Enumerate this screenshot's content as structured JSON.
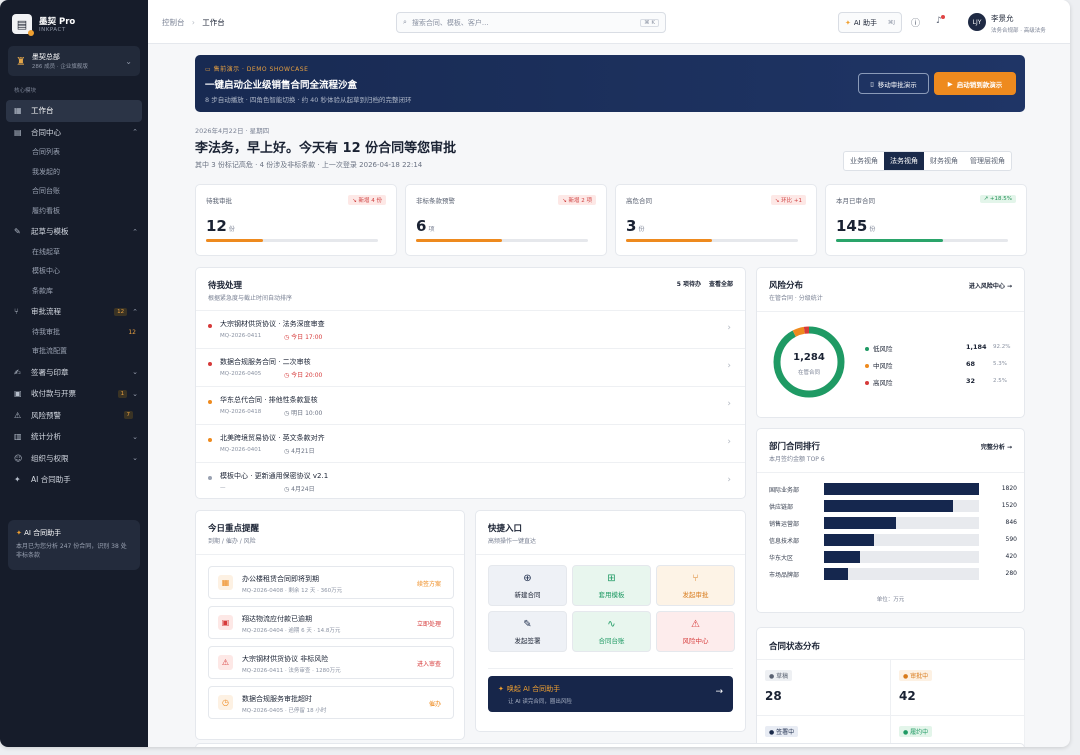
{
  "brand": {
    "name": "墨契 Pro",
    "sub": "INKPACT"
  },
  "org": {
    "name": "墨契总部",
    "sub": "286 成员 · 企业旗舰版"
  },
  "sidebar": {
    "section": "核心模块",
    "items": [
      {
        "label": "工作台",
        "icon": "▦"
      },
      {
        "label": "合同中心",
        "icon": "▤",
        "subs": [
          "合同列表",
          "我发起的",
          "合同台账",
          "履约看板"
        ]
      },
      {
        "label": "起草与模板",
        "icon": "✎",
        "subs": [
          "在线起草",
          "模板中心",
          "条款库"
        ]
      },
      {
        "label": "审批流程",
        "icon": "⑂",
        "count": "12",
        "subs": [
          "待我审批",
          "审批流配置"
        ],
        "subcount": "12"
      },
      {
        "label": "签署与印章",
        "icon": "✍"
      },
      {
        "label": "收付款与开票",
        "icon": "▣",
        "count": "1"
      },
      {
        "label": "风险预警",
        "icon": "⚠",
        "count": "7"
      },
      {
        "label": "统计分析",
        "icon": "▥"
      },
      {
        "label": "组织与权限",
        "icon": "☺"
      },
      {
        "label": "AI 合同助手",
        "icon": "✦"
      }
    ],
    "ai_card": {
      "title": "AI 合同助手",
      "desc": "本月已为您分析 247 份合同，识别 38 处非标条款"
    }
  },
  "topbar": {
    "crumb_root": "控制台",
    "crumb_current": "工作台",
    "search_placeholder": "搜索合同、模板、客户...",
    "search_key": "⌘ K",
    "ai_label": "AI 助手",
    "ai_key": "⌘J",
    "avatar": "LJY",
    "user_name": "李景允",
    "user_role": "法务合规部 · 高级法务"
  },
  "banner": {
    "tag": "售前演示 · DEMO SHOWCASE",
    "title": "一键启动企业级销售合同全流程沙盒",
    "desc": "8 步自动播放 · 四角色智能切换 · 约 40 秒体验从起草到归档的完整闭环",
    "btn_mobile": "移动审批演示",
    "btn_start": "启动销到款演示"
  },
  "header": {
    "date": "2026年4月22日 · 星期四",
    "greeting": "李法务，早上好。今天有 12 份合同等您审批",
    "sub": "其中 3 份标记高危 · 4 份涉及非标条款 · 上一次登录 2026-04-18 22:14",
    "views": [
      "业务视角",
      "法务视角",
      "财务视角",
      "管理层视角"
    ],
    "active_view": 1
  },
  "stats": [
    {
      "label": "待我审批",
      "badge": "↘ 新增 4 份",
      "value": "12",
      "unit": "份",
      "progress": 0.33,
      "color": "#ee8a1e",
      "badge_type": "r"
    },
    {
      "label": "非标条款预警",
      "badge": "↘ 新增 2 项",
      "value": "6",
      "unit": "项",
      "progress": 0.5,
      "color": "#ee8a1e",
      "badge_type": "r"
    },
    {
      "label": "高危合同",
      "badge": "↘ 环比 +1",
      "value": "3",
      "unit": "份",
      "progress": 0.5,
      "color": "#ee8a1e",
      "badge_type": "r"
    },
    {
      "label": "本月已审合同",
      "badge": "↗ +18.5%",
      "value": "145",
      "unit": "份",
      "progress": 0.62,
      "color": "#2aa46a",
      "badge_type": "g"
    }
  ],
  "pending": {
    "title": "待我处理",
    "sub": "根据紧急度与截止时间自动排序",
    "count": "5 项待办",
    "view_all": "查看全部",
    "rows": [
      {
        "title": "大宗钢材供货协议 · 法务深度审查",
        "code": "MQ-2026-0411",
        "due": "今日 17:00",
        "dot": "#d63a3a",
        "due_color": "#d63a3a"
      },
      {
        "title": "数据合规服务合同 · 二次审核",
        "code": "MQ-2026-0405",
        "due": "今日 20:00",
        "dot": "#d63a3a",
        "due_color": "#d63a3a"
      },
      {
        "title": "华东总代合同 · 排他性条款复核",
        "code": "MQ-2026-0418",
        "due": "明日 10:00",
        "dot": "#ee8a1e",
        "due_color": "#6a7282"
      },
      {
        "title": "北美跨境贸易协议 · 英文条款对齐",
        "code": "MQ-2026-0401",
        "due": "4月21日",
        "dot": "#ee8a1e",
        "due_color": "#6a7282"
      },
      {
        "title": "模板中心 · 更新通用保密协议 v2.1",
        "code": "—",
        "due": "4月24日",
        "dot": "#9aa2b2",
        "due_color": "#6a7282"
      }
    ]
  },
  "risk": {
    "title": "风险分布",
    "sub": "在管合同 · 分级统计",
    "link": "进入风险中心 →",
    "total": "1,284",
    "total_label": "在管合同",
    "items": [
      {
        "label": "低风险",
        "value": "1,184",
        "pct": "92.2%",
        "color": "#1f9a64",
        "share": 0.922
      },
      {
        "label": "中风险",
        "value": "68",
        "pct": "5.3%",
        "color": "#ee8a1e",
        "share": 0.053
      },
      {
        "label": "高风险",
        "value": "32",
        "pct": "2.5%",
        "color": "#d63a3a",
        "share": 0.025
      }
    ]
  },
  "dept": {
    "title": "部门合同排行",
    "sub": "本月签约金额 TOP 6",
    "link": "完整分析 →",
    "unit": "单位：万元",
    "rows": [
      {
        "name": "国际业务部",
        "value": 1820
      },
      {
        "name": "供应链部",
        "value": 1520
      },
      {
        "name": "销售运营部",
        "value": 846
      },
      {
        "name": "信息技术部",
        "value": 590
      },
      {
        "name": "华东大区",
        "value": 420
      },
      {
        "name": "市场品牌部",
        "value": 280
      }
    ],
    "max": 1820
  },
  "reminders": {
    "title": "今日重点提醒",
    "sub": "到期 / 催办 / 风险",
    "items": [
      {
        "title": "办公楼租赁合同即将到期",
        "meta": "MQ-2026-0408 · 剩余 12 天 · 360万元",
        "action": "续签方案",
        "icon": "▦",
        "color": "#ee8a1e",
        "bg": "#fdf1e3"
      },
      {
        "title": "翔达物流应付款已逾期",
        "meta": "MQ-2026-0404 · 逾期 6 天 · 14.8万元",
        "action": "立即处理",
        "icon": "▣",
        "color": "#d63a3a",
        "bg": "#fde8e6"
      },
      {
        "title": "大宗钢材供货协议 非标风险",
        "meta": "MQ-2026-0411 · 法务审查 · 1280万元",
        "action": "进入审查",
        "icon": "⚠",
        "color": "#d63a3a",
        "bg": "#fde8e6"
      },
      {
        "title": "数据合规服务审批超时",
        "meta": "MQ-2026-0405 · 已停留 18 小时",
        "action": "催办",
        "icon": "◷",
        "color": "#ee8a1e",
        "bg": "#fdf1e3"
      }
    ]
  },
  "quick": {
    "title": "快捷入口",
    "sub": "高频操作一键直达",
    "items": [
      {
        "label": "新建合同",
        "icon": "⊕",
        "color": "#1a2a4a",
        "bg": "#eef1f6"
      },
      {
        "label": "套用模板",
        "icon": "⊞",
        "color": "#1f9a64",
        "bg": "#e8f6ee"
      },
      {
        "label": "发起审批",
        "icon": "⑂",
        "color": "#d87a1a",
        "bg": "#fdf3e6"
      },
      {
        "label": "发起签署",
        "icon": "✎",
        "color": "#1a2a4a",
        "bg": "#eef1f6"
      },
      {
        "label": "合同台账",
        "icon": "∿",
        "color": "#1f9a64",
        "bg": "#e8f6ee"
      },
      {
        "label": "风险中心",
        "icon": "⚠",
        "color": "#d63a3a",
        "bg": "#fdecec"
      }
    ],
    "ai": {
      "title": "唤起 AI 合同助手",
      "desc": "让 AI 读完合同，圈出风险"
    }
  },
  "status": {
    "title": "合同状态分布",
    "items": [
      {
        "label": "● 草稿",
        "value": "28",
        "color": "#5a6272",
        "bg": "#eef0f3"
      },
      {
        "label": "● 审批中",
        "value": "42",
        "color": "#d87a1a",
        "bg": "#fdf1e3"
      },
      {
        "label": "● 签署中",
        "value": "",
        "color": "#1a2a4a",
        "bg": "#e8ecf4"
      },
      {
        "label": "● 履约中",
        "value": "",
        "color": "#1f9a64",
        "bg": "#e3f5ea"
      }
    ]
  }
}
